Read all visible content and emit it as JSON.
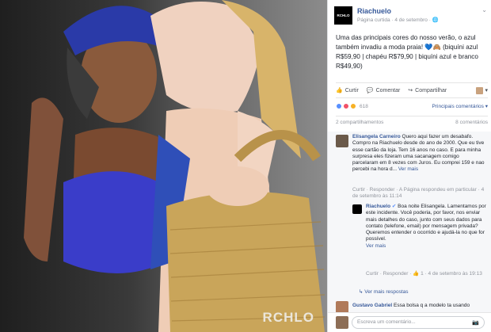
{
  "photo": {
    "watermark": "RCHLO"
  },
  "post": {
    "page_name": "Riachuelo",
    "avatar_text": "RCHLO",
    "meta": "Página curtida · 4 de setembro · ",
    "text": "Uma das principais cores do nosso verão, o azul também invadiu a moda praia! 💙🙈 (biquíni azul R$59,90 | chapéu R$79,90 | biquíni azul e branco R$49,90)"
  },
  "actions": {
    "like": "Curtir",
    "comment": "Comentar",
    "share": "Compartilhar"
  },
  "reactions": {
    "count": "618",
    "top_comments": "Principais comentários ▾"
  },
  "shares": {
    "left": "2 compartilhamentos",
    "right": "8 comentários"
  },
  "comments": [
    {
      "name": "Elisangela Carneiro",
      "text": " Quero aqui fazer um desabafo. Compro na Riachuelo desde do ano de 2000. Que eu tive esse cartão da loja. Tem 16 anos no caso. E para minha surpresa eles fizeram uma sacanagem comigo parcelaram em 8 vezes com Juros. Eu comprei 159 e nao percebi na hora d...",
      "see_more": "Ver mais",
      "meta": "Curtir · Responder · A Página respondeu em particular · 4 de setembro às 11:14"
    },
    {
      "name": "Riachuelo",
      "text": " Boa noite Elisangela. Lamentamos por este incidente. Você poderia, por favor, nos enviar mais detalhes do caso, junto com seus dados para contato (telefone, email) por mensagem privada?\nQueremos entender o ocorrido e ajudá-la no que for possível.",
      "see_more": "Ver mais",
      "meta": "Curtir · Responder · 👍 1 · 4 de setembro às 19:13"
    }
  ],
  "more_replies": "Ver mais respostas",
  "third_comment": {
    "name": "Gustavo Gabriel",
    "text": " Essa bolsa q a modelo ta usando"
  },
  "compose": {
    "placeholder": "Escreva um comentário..."
  }
}
